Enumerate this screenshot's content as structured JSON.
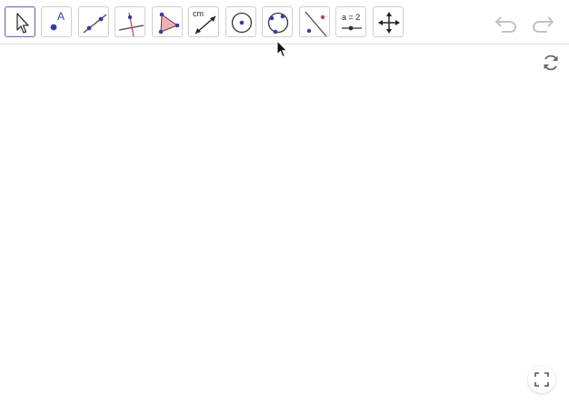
{
  "toolbar": {
    "tools": [
      {
        "name": "move-tool",
        "icon": "arrow-cursor-icon"
      },
      {
        "name": "point-tool",
        "icon": "point-icon",
        "label": "A"
      },
      {
        "name": "line-tool",
        "icon": "line-through-points-icon"
      },
      {
        "name": "perpendicular-line-tool",
        "icon": "perpendicular-line-icon"
      },
      {
        "name": "polygon-tool",
        "icon": "polygon-icon"
      },
      {
        "name": "distance-tool",
        "icon": "distance-icon",
        "label": "cm"
      },
      {
        "name": "circle-center-point-tool",
        "icon": "circle-center-icon"
      },
      {
        "name": "circle-three-points-tool",
        "icon": "circle-three-points-icon"
      },
      {
        "name": "reflect-tool",
        "icon": "reflect-about-line-icon"
      },
      {
        "name": "slider-tool",
        "icon": "slider-icon",
        "label": "a = 2"
      },
      {
        "name": "move-graphics-view-tool",
        "icon": "move-view-icon"
      }
    ],
    "undo": {
      "icon": "undo-icon"
    },
    "redo": {
      "icon": "redo-icon"
    }
  },
  "graphics": {
    "refresh": {
      "icon": "refresh-icon"
    },
    "fullscreen": {
      "icon": "fullscreen-icon"
    }
  },
  "colors": {
    "selected_border": "#6f6fb8",
    "point_blue": "#2f3ea8",
    "accent_red": "#cc3d5a",
    "polygon_fill": "#e9b1b6"
  }
}
